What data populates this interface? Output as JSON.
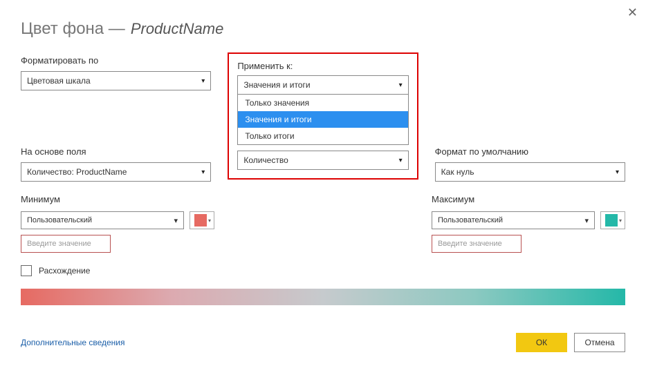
{
  "title": {
    "main": "Цвет фона —",
    "sub": "ProductName"
  },
  "format_by": {
    "label": "Форматировать по",
    "value": "Цветовая шкала"
  },
  "apply_to": {
    "label": "Применить к:",
    "value": "Значения и итоги",
    "options": [
      "Только значения",
      "Значения и итоги",
      "Только итоги"
    ],
    "below_value": "Количество"
  },
  "based_on": {
    "label": "На основе поля",
    "value": "Количество: ProductName"
  },
  "default_format": {
    "label": "Формат по умолчанию",
    "value": "Как нуль"
  },
  "minimum": {
    "label": "Минимум",
    "mode": "Пользовательский",
    "placeholder": "Введите значение",
    "color": "#e66a62"
  },
  "maximum": {
    "label": "Максимум",
    "mode": "Пользовательский",
    "placeholder": "Введите значение",
    "color": "#24b8a8"
  },
  "diverging": {
    "label": "Расхождение"
  },
  "footer": {
    "link": "Дополнительные сведения",
    "ok": "ОК",
    "cancel": "Отмена"
  }
}
